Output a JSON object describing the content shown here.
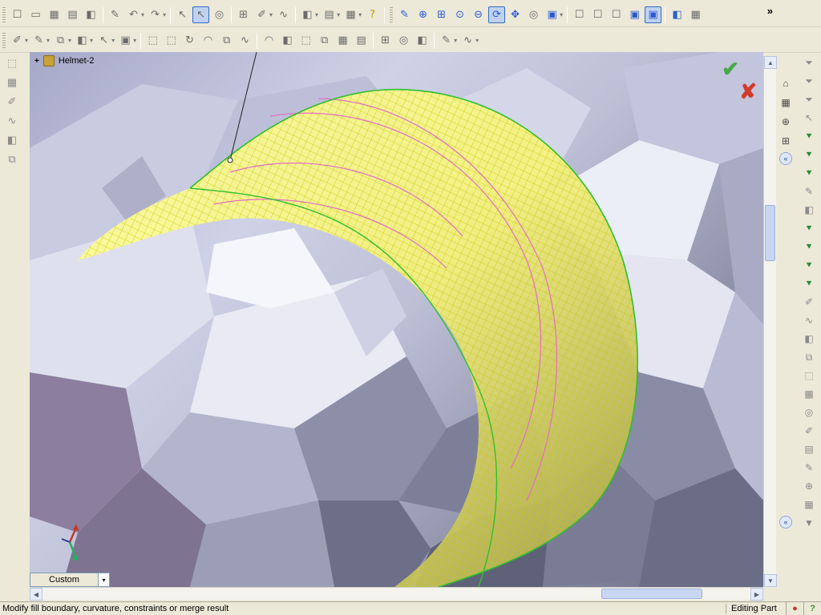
{
  "tree": {
    "expand_symbol": "+",
    "part_name": "Helmet-2"
  },
  "view_selector": {
    "value": "Custom",
    "arrow": "▾"
  },
  "statusbar": {
    "message": "Modify fill boundary, curvature, constraints or merge result",
    "mode": "Editing Part",
    "rebuild_icon": "●",
    "help_icon": "?"
  },
  "confirm": {
    "ok_glyph": "✔",
    "cancel_glyph": "✘"
  },
  "scroll": {
    "up": "▲",
    "down": "▼",
    "left": "◀",
    "right": "▶",
    "collapse": "«",
    "overflow": "»"
  },
  "icons": {
    "new": "☐",
    "open": "▭",
    "save": "▦",
    "print": "▤",
    "undo": "↶",
    "redo": "↷",
    "select": "↖",
    "zoom_fit": "⊕",
    "zoom_area": "⊞",
    "zoom_in": "⊙",
    "zoom_out": "⊖",
    "rotate": "⟳",
    "pan": "✥",
    "view": "▣",
    "help": "?",
    "smart": "✎",
    "sketch": "✐",
    "extrude": "⬚",
    "revolve": "↻",
    "sweep": "∿",
    "loft": "⧉",
    "fillet": "◠",
    "feature": "◧",
    "tree": "⌂",
    "property": "▦",
    "config": "◎",
    "filter": "⏷",
    "filter_on": "⯆"
  },
  "colors": {
    "accept": "#47a84a",
    "cancel": "#d43a2c",
    "surface_fill": "#ffff33",
    "surface_mesh": "#b8b800",
    "surface_boundary": "#2ec02e",
    "surface_curvature": "#e46ec4",
    "model_light": "#e6e7f2",
    "model_shadow": "#6f7088"
  },
  "triad_axes": [
    "X",
    "Y",
    "Z"
  ]
}
